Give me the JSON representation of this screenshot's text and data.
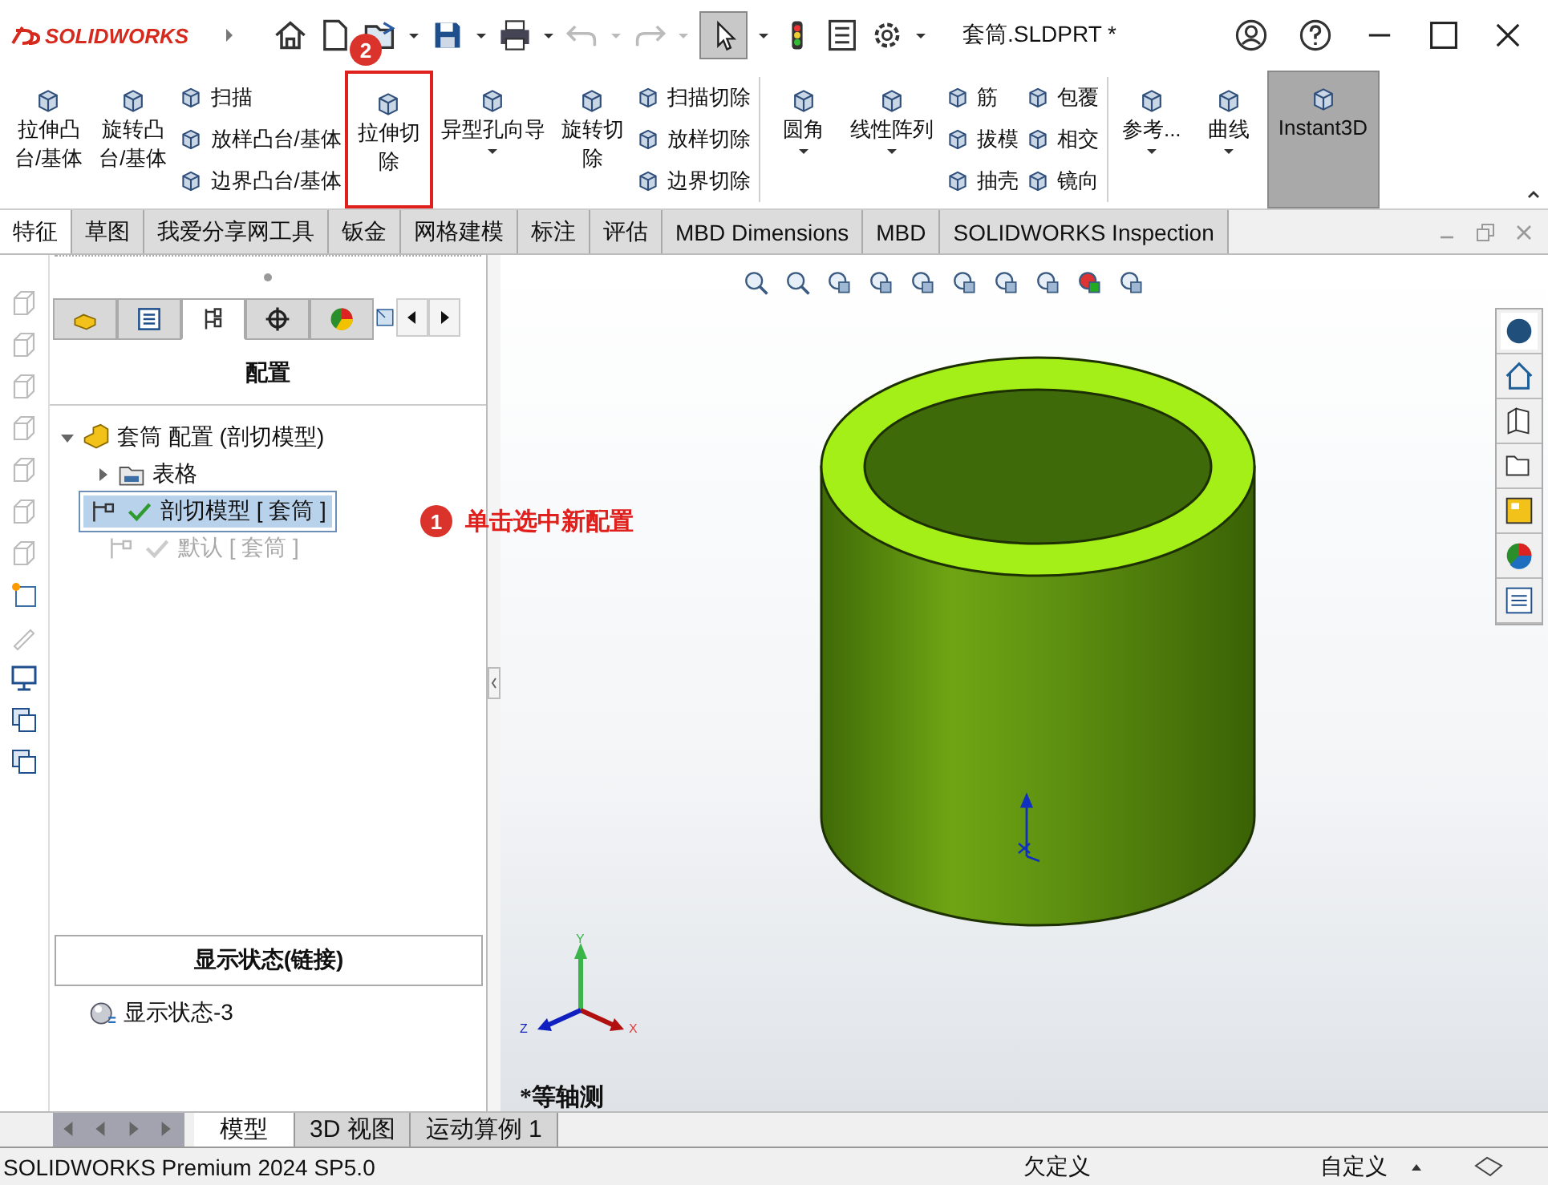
{
  "window": {
    "title": "套筒.SLDPRT *"
  },
  "logo": {
    "text": "SOLIDWORKS"
  },
  "quick_badge": {
    "number": "2"
  },
  "ribbon": {
    "groups": [
      {
        "columns": [
          {
            "kind": "large",
            "lines": [
              "拉伸凸",
              "台/基体"
            ],
            "dropdown": false,
            "highlighted": false,
            "on": false
          },
          {
            "kind": "large",
            "lines": [
              "旋转凸",
              "台/基体"
            ],
            "dropdown": false,
            "highlighted": false,
            "on": false
          },
          {
            "kind": "stack",
            "items": [
              "扫描",
              "放样凸台/基体",
              "边界凸台/基体"
            ]
          },
          {
            "kind": "large",
            "lines": [
              "拉伸切",
              "除"
            ],
            "dropdown": false,
            "highlighted": true,
            "on": false
          },
          {
            "kind": "large",
            "lines": [
              "异型孔向导"
            ],
            "dropdown": true,
            "highlighted": false,
            "on": false
          },
          {
            "kind": "large",
            "lines": [
              "旋转切",
              "除"
            ],
            "dropdown": false,
            "highlighted": false,
            "on": false
          },
          {
            "kind": "stack",
            "items": [
              "扫描切除",
              "放样切除",
              "边界切除"
            ]
          }
        ]
      },
      {
        "columns": [
          {
            "kind": "large",
            "lines": [
              "圆角"
            ],
            "dropdown": true,
            "highlighted": false,
            "on": false
          },
          {
            "kind": "large",
            "lines": [
              "线性阵列"
            ],
            "dropdown": true,
            "highlighted": false,
            "on": false
          },
          {
            "kind": "stack",
            "items": [
              "筋",
              "拔模",
              "抽壳"
            ]
          },
          {
            "kind": "stack",
            "items": [
              "包覆",
              "相交",
              "镜向"
            ]
          }
        ]
      },
      {
        "columns": [
          {
            "kind": "large",
            "lines": [
              "参考..."
            ],
            "dropdown": true,
            "highlighted": false,
            "on": false
          },
          {
            "kind": "large",
            "lines": [
              "曲线"
            ],
            "dropdown": true,
            "highlighted": false,
            "on": false
          },
          {
            "kind": "large",
            "lines": [
              "Instant3D"
            ],
            "dropdown": false,
            "highlighted": false,
            "on": true
          }
        ]
      }
    ]
  },
  "tabs": [
    {
      "label": "特征",
      "selected": true
    },
    {
      "label": "草图",
      "selected": false
    },
    {
      "label": "我爱分享网工具",
      "selected": false
    },
    {
      "label": "钣金",
      "selected": false
    },
    {
      "label": "网格建模",
      "selected": false
    },
    {
      "label": "标注",
      "selected": false
    },
    {
      "label": "评估",
      "selected": false
    },
    {
      "label": "MBD Dimensions",
      "selected": false
    },
    {
      "label": "MBD",
      "selected": false
    },
    {
      "label": "SOLIDWORKS Inspection",
      "selected": false
    }
  ],
  "panel": {
    "icon_tabs": [
      {
        "selected": false
      },
      {
        "selected": false
      },
      {
        "selected": true
      },
      {
        "selected": false
      },
      {
        "selected": false
      }
    ],
    "title": "配置",
    "tree": {
      "label": "套筒 配置 (剖切模型)",
      "expanded": true,
      "children": [
        {
          "kind": "folder",
          "label": "表格",
          "expanded": false
        },
        {
          "kind": "config",
          "label": "剖切模型 [ 套筒 ]",
          "selected": true,
          "highlighted": true,
          "disabled": false
        },
        {
          "kind": "config",
          "label": "默认 [ 套筒 ]",
          "selected": false,
          "highlighted": false,
          "disabled": true
        }
      ]
    },
    "callout": {
      "number": "1",
      "text": "单击选中新配置"
    },
    "display_states": {
      "title": "显示状态(链接)",
      "items": [
        "显示状态-3"
      ]
    }
  },
  "viewport": {
    "view_label": "*等轴测",
    "triad": {
      "x": "X",
      "y": "Y",
      "z": "Z"
    }
  },
  "bottom_tabs": [
    {
      "label": "模型",
      "selected": true
    },
    {
      "label": "3D 视图",
      "selected": false
    },
    {
      "label": "运动算例 1",
      "selected": false
    }
  ],
  "status_bar": {
    "product": "SOLIDWORKS Premium 2024 SP5.0",
    "state": "欠定义",
    "units": "自定义"
  }
}
